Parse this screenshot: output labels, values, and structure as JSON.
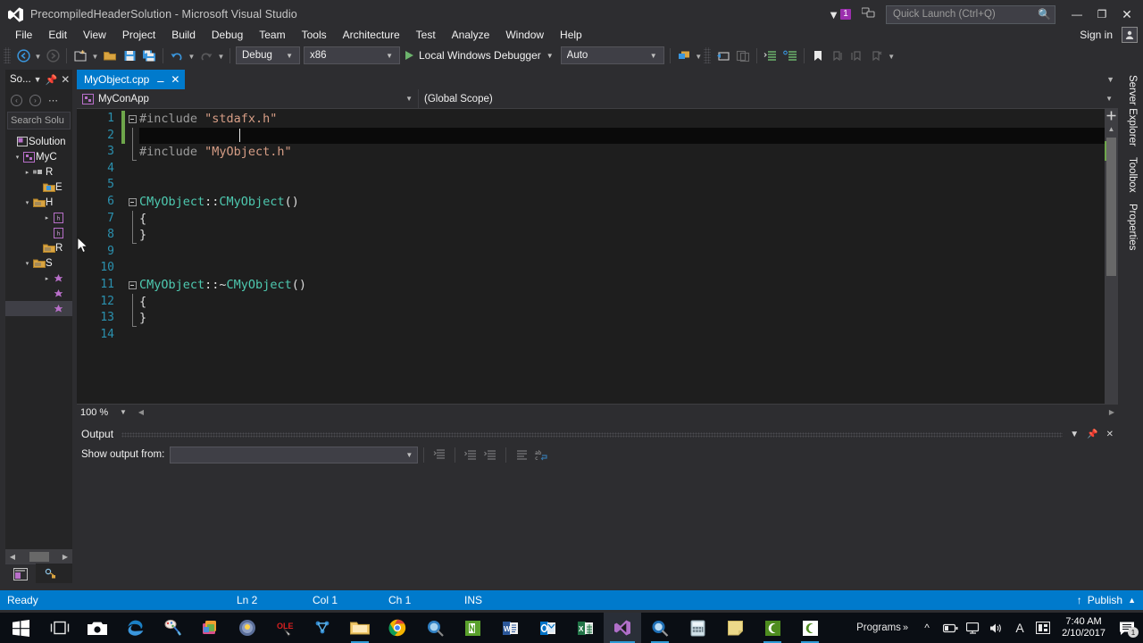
{
  "titlebar": {
    "title": "PrecompiledHeaderSolution - Microsoft Visual Studio",
    "logo_icon": "visual-studio-logo-icon",
    "flag_icon": "notification-flag-icon",
    "flag_count": "1",
    "feedback_icon": "send-feedback-icon",
    "quick_launch_placeholder": "Quick Launch (Ctrl+Q)",
    "quick_launch_value": "",
    "search_icon": "magnifier-icon",
    "minimize": "—",
    "maximize": "❐",
    "close": "✕"
  },
  "menubar": {
    "items": [
      {
        "label": "File"
      },
      {
        "label": "Edit"
      },
      {
        "label": "View"
      },
      {
        "label": "Project"
      },
      {
        "label": "Build"
      },
      {
        "label": "Debug"
      },
      {
        "label": "Team"
      },
      {
        "label": "Tools"
      },
      {
        "label": "Architecture"
      },
      {
        "label": "Test"
      },
      {
        "label": "Analyze"
      },
      {
        "label": "Window"
      },
      {
        "label": "Help"
      }
    ],
    "sign_in": "Sign in",
    "account_icon": "user-account-icon"
  },
  "toolbar": {
    "nav_back_icon": "navigate-backward-icon",
    "nav_forward_icon": "navigate-forward-icon",
    "new_project_icon": "new-project-icon",
    "open_file_icon": "open-file-icon",
    "save_icon": "save-icon",
    "save_all_icon": "save-all-icon",
    "undo_icon": "undo-icon",
    "redo_icon": "redo-icon",
    "configuration": "Debug",
    "platform": "x86",
    "start_label": "Local Windows Debugger",
    "start_icon": "play-icon",
    "solution_platform": "Auto",
    "attach_icon": "attach-to-process-icon",
    "step_icon": "step-into-icon",
    "window_icon": "new-window-icon",
    "comment_icon": "comment-selection-icon",
    "uncomment_icon": "uncomment-selection-icon",
    "bookmark_icon": "bookmark-icon",
    "prev_bookmark_icon": "previous-bookmark-icon",
    "next_bookmark_icon": "next-bookmark-icon",
    "clear_bookmark_icon": "clear-bookmarks-icon",
    "overflow_icon": "toolbar-overflow-icon"
  },
  "solution_explorer": {
    "title": "So...",
    "dropdown_icon": "chevron-down-icon",
    "pin_icon": "pin-icon",
    "close_icon": "close-icon",
    "back_icon": "back-icon",
    "forward_icon": "forward-icon",
    "overflow_icon": "overflow-icon",
    "search_placeholder": "Search Solu",
    "search_icon": "search-solution-icon",
    "tree": [
      {
        "indent": 0,
        "twisty": "",
        "icon": "solution-icon",
        "label": "Solution"
      },
      {
        "indent": 1,
        "twisty": "▾",
        "icon": "cpp-project-icon",
        "label": "MyC"
      },
      {
        "indent": 2,
        "twisty": "▸",
        "icon": "references-icon",
        "label": "R"
      },
      {
        "indent": 3,
        "twisty": "",
        "icon": "folder-icon",
        "label": "E"
      },
      {
        "indent": 2,
        "twisty": "▾",
        "icon": "folder-icon",
        "label": "H"
      },
      {
        "indent": 3,
        "twisty": "▸",
        "icon": "header-file-icon",
        "label": ""
      },
      {
        "indent": 3,
        "twisty": "",
        "icon": "header-file-icon",
        "label": ""
      },
      {
        "indent": 2,
        "twisty": "",
        "icon": "folder-icon",
        "label": "R"
      },
      {
        "indent": 2,
        "twisty": "▾",
        "icon": "folder-icon",
        "label": "S"
      },
      {
        "indent": 3,
        "twisty": "▸",
        "icon": "cpp-file-icon",
        "label": ""
      },
      {
        "indent": 3,
        "twisty": "",
        "icon": "cpp-file-icon",
        "label": ""
      },
      {
        "indent": 3,
        "twisty": "",
        "icon": "cpp-file-icon",
        "label": "",
        "selected": true
      }
    ],
    "hscroll_left": "◀",
    "hscroll_right": "▶",
    "tabs": [
      {
        "icon": "solution-explorer-tab-icon",
        "active": true
      },
      {
        "icon": "class-view-tab-icon",
        "active": false
      }
    ]
  },
  "editor": {
    "tab_label": "MyObject.cpp",
    "tab_pin_icon": "pin-icon",
    "tab_close_icon": "close-icon",
    "tabstrip_overflow_icon": "chevron-down-icon",
    "nav_project": "MyConApp",
    "nav_project_icon": "cpp-project-icon",
    "nav_scope": "(Global Scope)",
    "nav_arrow_icon": "chevron-down-icon",
    "zoom": "100 %",
    "zoom_arrow_icon": "chevron-down-icon",
    "lines": [
      {
        "num": "1",
        "fold": "minus",
        "changed": true,
        "indent": "",
        "tokens": [
          {
            "t": "#include ",
            "c": "pre"
          },
          {
            "t": "\"stdafx.h\"",
            "c": "str"
          }
        ]
      },
      {
        "num": "2",
        "fold": "bar",
        "changed": true,
        "selected": true,
        "indent": "",
        "tokens": []
      },
      {
        "num": "3",
        "fold": "barend",
        "changed": false,
        "indent": "",
        "tokens": [
          {
            "t": "#include ",
            "c": "pre"
          },
          {
            "t": "\"MyObject.h\"",
            "c": "str"
          }
        ]
      },
      {
        "num": "4",
        "fold": "",
        "changed": false,
        "indent": "",
        "tokens": []
      },
      {
        "num": "5",
        "fold": "",
        "changed": false,
        "indent": "",
        "tokens": []
      },
      {
        "num": "6",
        "fold": "minus",
        "changed": false,
        "indent": "",
        "tokens": [
          {
            "t": "CMyObject",
            "c": "type"
          },
          {
            "t": "::",
            "c": "plain"
          },
          {
            "t": "CMyObject",
            "c": "type"
          },
          {
            "t": "()",
            "c": "plain"
          }
        ]
      },
      {
        "num": "7",
        "fold": "bar",
        "changed": false,
        "indent": "",
        "tokens": [
          {
            "t": "{",
            "c": "plain"
          }
        ]
      },
      {
        "num": "8",
        "fold": "barend",
        "changed": false,
        "indent": "",
        "tokens": [
          {
            "t": "}",
            "c": "plain"
          }
        ]
      },
      {
        "num": "9",
        "fold": "",
        "changed": false,
        "indent": "",
        "tokens": []
      },
      {
        "num": "10",
        "fold": "",
        "changed": false,
        "indent": "",
        "tokens": []
      },
      {
        "num": "11",
        "fold": "minus",
        "changed": false,
        "indent": "",
        "tokens": [
          {
            "t": "CMyObject",
            "c": "type"
          },
          {
            "t": "::~",
            "c": "plain"
          },
          {
            "t": "CMyObject",
            "c": "type"
          },
          {
            "t": "()",
            "c": "plain"
          }
        ]
      },
      {
        "num": "12",
        "fold": "bar",
        "changed": false,
        "indent": "",
        "tokens": [
          {
            "t": "{",
            "c": "plain"
          }
        ]
      },
      {
        "num": "13",
        "fold": "barend",
        "changed": false,
        "indent": "",
        "tokens": [
          {
            "t": "}",
            "c": "plain"
          }
        ]
      },
      {
        "num": "14",
        "fold": "",
        "changed": false,
        "indent": "",
        "tokens": []
      }
    ],
    "scroll_up_icon": "scroll-up-icon",
    "scroll_down_icon": "scroll-down-icon",
    "split_icon": "split-view-icon"
  },
  "right_tabs": [
    {
      "label": "Server Explorer"
    },
    {
      "label": "Toolbox"
    },
    {
      "label": "Properties"
    }
  ],
  "output": {
    "title": "Output",
    "dropdown_icon": "chevron-down-icon",
    "pin_icon": "pin-icon",
    "close_icon": "close-icon",
    "show_from_label": "Show output from:",
    "show_from_value": "",
    "combo_arrow_icon": "chevron-down-icon",
    "find_icon": "find-message-icon",
    "clear_icon": "clear-all-icon",
    "goto_icon": "go-to-message-icon",
    "wrap_icon": "toggle-word-wrap-icon",
    "autoscroll_icon": "toggle-autoscroll-icon"
  },
  "statusbar": {
    "state": "Ready",
    "line": "Ln 2",
    "col": "Col 1",
    "ch": "Ch 1",
    "insert_mode": "INS",
    "publish": "Publish",
    "publish_icon": "upload-arrow-icon",
    "publish_arrow_icon": "chevron-up-icon"
  },
  "taskbar": {
    "start_icon": "windows-start-icon",
    "items": [
      {
        "icon": "task-view-icon",
        "name": "task-view"
      },
      {
        "icon": "camera-icon",
        "name": "camera"
      },
      {
        "icon": "edge-icon",
        "name": "microsoft-edge"
      },
      {
        "icon": "paint-icon",
        "name": "paint"
      },
      {
        "icon": "store-icon",
        "name": "microsoft-store"
      },
      {
        "icon": "orb-icon",
        "name": "media-player"
      },
      {
        "icon": "red-app-icon",
        "name": "ole-tool"
      },
      {
        "icon": "blue-app-icon",
        "name": "network-app"
      },
      {
        "icon": "explorer-icon",
        "name": "file-explorer",
        "open": true
      },
      {
        "icon": "chrome-icon",
        "name": "google-chrome"
      },
      {
        "icon": "globe-app-icon",
        "name": "browser-app"
      },
      {
        "icon": "green-note-icon",
        "name": "onenote-green"
      },
      {
        "icon": "word-icon",
        "name": "microsoft-word"
      },
      {
        "icon": "outlook-icon",
        "name": "microsoft-outlook"
      },
      {
        "icon": "excel-icon",
        "name": "microsoft-excel"
      },
      {
        "icon": "visual-studio-icon",
        "name": "visual-studio",
        "active": true
      },
      {
        "icon": "blue-globe-icon",
        "name": "search-app",
        "open": true
      },
      {
        "icon": "calculator-icon",
        "name": "calculator"
      },
      {
        "icon": "sticky-note-icon",
        "name": "sticky-notes"
      },
      {
        "icon": "camtasia-green-icon",
        "name": "camtasia-studio",
        "open": true
      },
      {
        "icon": "camtasia-white-icon",
        "name": "camtasia-recorder",
        "open": true
      }
    ],
    "programs_label": "Programs",
    "programs_chevron": "»",
    "tray": {
      "expand_icon": "show-hidden-icons-icon",
      "battery_icon": "battery-icon",
      "network_icon": "network-icon",
      "volume_icon": "volume-icon",
      "language_icon": "input-indicator-icon",
      "ime_icon": "ime-mode-icon",
      "time": "7:40 AM",
      "date": "2/10/2017",
      "action_center_icon": "action-center-icon",
      "action_center_count": "1"
    }
  }
}
